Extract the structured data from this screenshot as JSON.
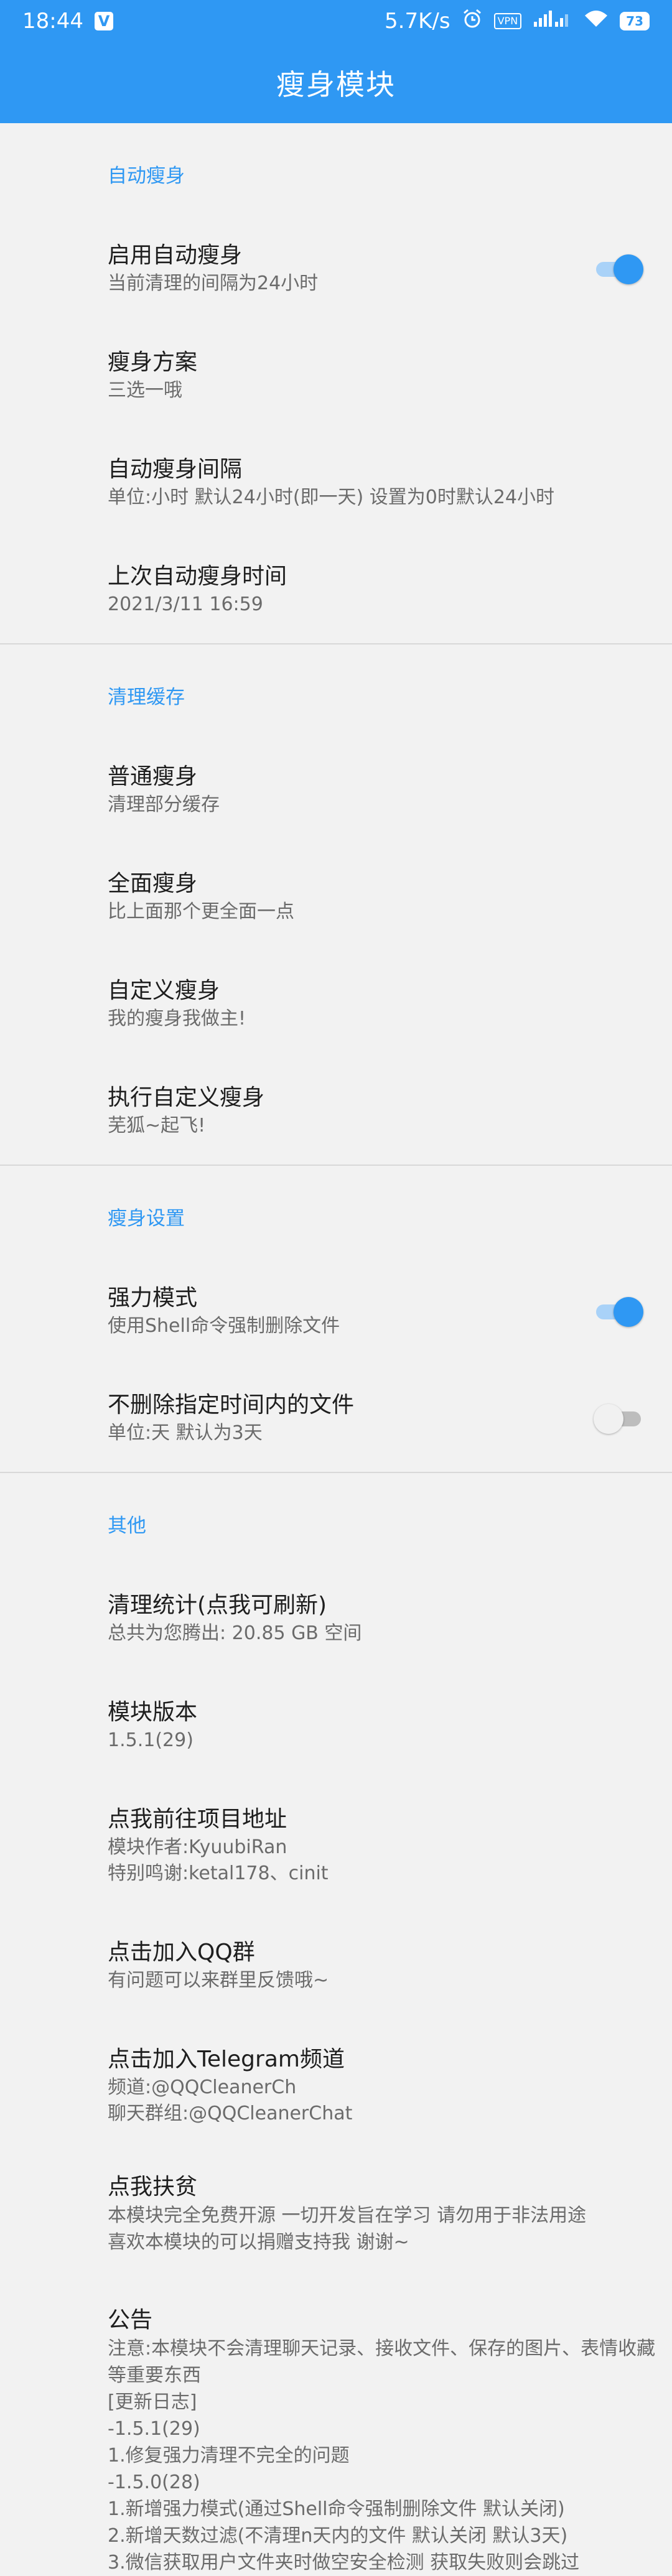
{
  "status_bar": {
    "time": "18:44",
    "app_icon_letter": "V",
    "net_speed": "5.7K/s",
    "alarm_icon": "alarm-icon",
    "vpn": "VPN",
    "signal_icon": "signal-icon",
    "wifi_icon": "wifi-icon",
    "battery": "73"
  },
  "app_bar": {
    "title": "瘦身模块"
  },
  "sections": {
    "auto": {
      "header": "自动瘦身",
      "enable": {
        "title": "启用自动瘦身",
        "summary": "当前清理的间隔为24小时",
        "on": true
      },
      "plan": {
        "title": "瘦身方案",
        "summary": "三选一哦"
      },
      "interval": {
        "title": "自动瘦身间隔",
        "summary": "单位:小时 默认24小时(即一天) 设置为0时默认24小时"
      },
      "last": {
        "title": "上次自动瘦身时间",
        "summary": "2021/3/11 16:59"
      }
    },
    "clean": {
      "header": "清理缓存",
      "normal": {
        "title": "普通瘦身",
        "summary": "清理部分缓存"
      },
      "full": {
        "title": "全面瘦身",
        "summary": "比上面那个更全面一点"
      },
      "custom": {
        "title": "自定义瘦身",
        "summary": "我的瘦身我做主!"
      },
      "run_custom": {
        "title": "执行自定义瘦身",
        "summary": "芜狐~起飞!"
      }
    },
    "settings": {
      "header": "瘦身设置",
      "force": {
        "title": "强力模式",
        "summary": "使用Shell命令强制删除文件",
        "on": true
      },
      "keep": {
        "title": "不删除指定时间内的文件",
        "summary": "单位:天 默认为3天",
        "on": false
      }
    },
    "other": {
      "header": "其他",
      "stats": {
        "title": "清理统计(点我可刷新)",
        "summary": "总共为您腾出: 20.85 GB 空间"
      },
      "version": {
        "title": "模块版本",
        "summary": "1.5.1(29)"
      },
      "project": {
        "title": "点我前往项目地址",
        "summary": "模块作者:KyuubiRan\n特别鸣谢:ketal178、cinit"
      },
      "qq": {
        "title": "点击加入QQ群",
        "summary": "有问题可以来群里反馈哦~"
      },
      "telegram": {
        "title": "点击加入Telegram频道",
        "summary": "频道:@QQCleanerCh\n聊天群组:@QQCleanerChat"
      },
      "donate": {
        "title": "点我扶贫",
        "summary": "本模块完全免费开源 一切开发旨在学习 请勿用于非法用途\n喜欢本模块的可以捐赠支持我 谢谢~"
      },
      "notice": {
        "title": "公告",
        "summary": "注意:本模块不会清理聊天记录、接收文件、保存的图片、表情收藏等重要东西\n[更新日志]\n-1.5.1(29)\n1.修复强力清理不完全的问题\n-1.5.0(28)\n1.新增强力模式(通过Shell命令强制删除文件 默认关闭)\n2.新增天数过滤(不清理n天内的文件 默认关闭 默认3天)\n3.微信获取用户文件夹时做空安全检测 获取失败则会跳过"
      }
    }
  }
}
